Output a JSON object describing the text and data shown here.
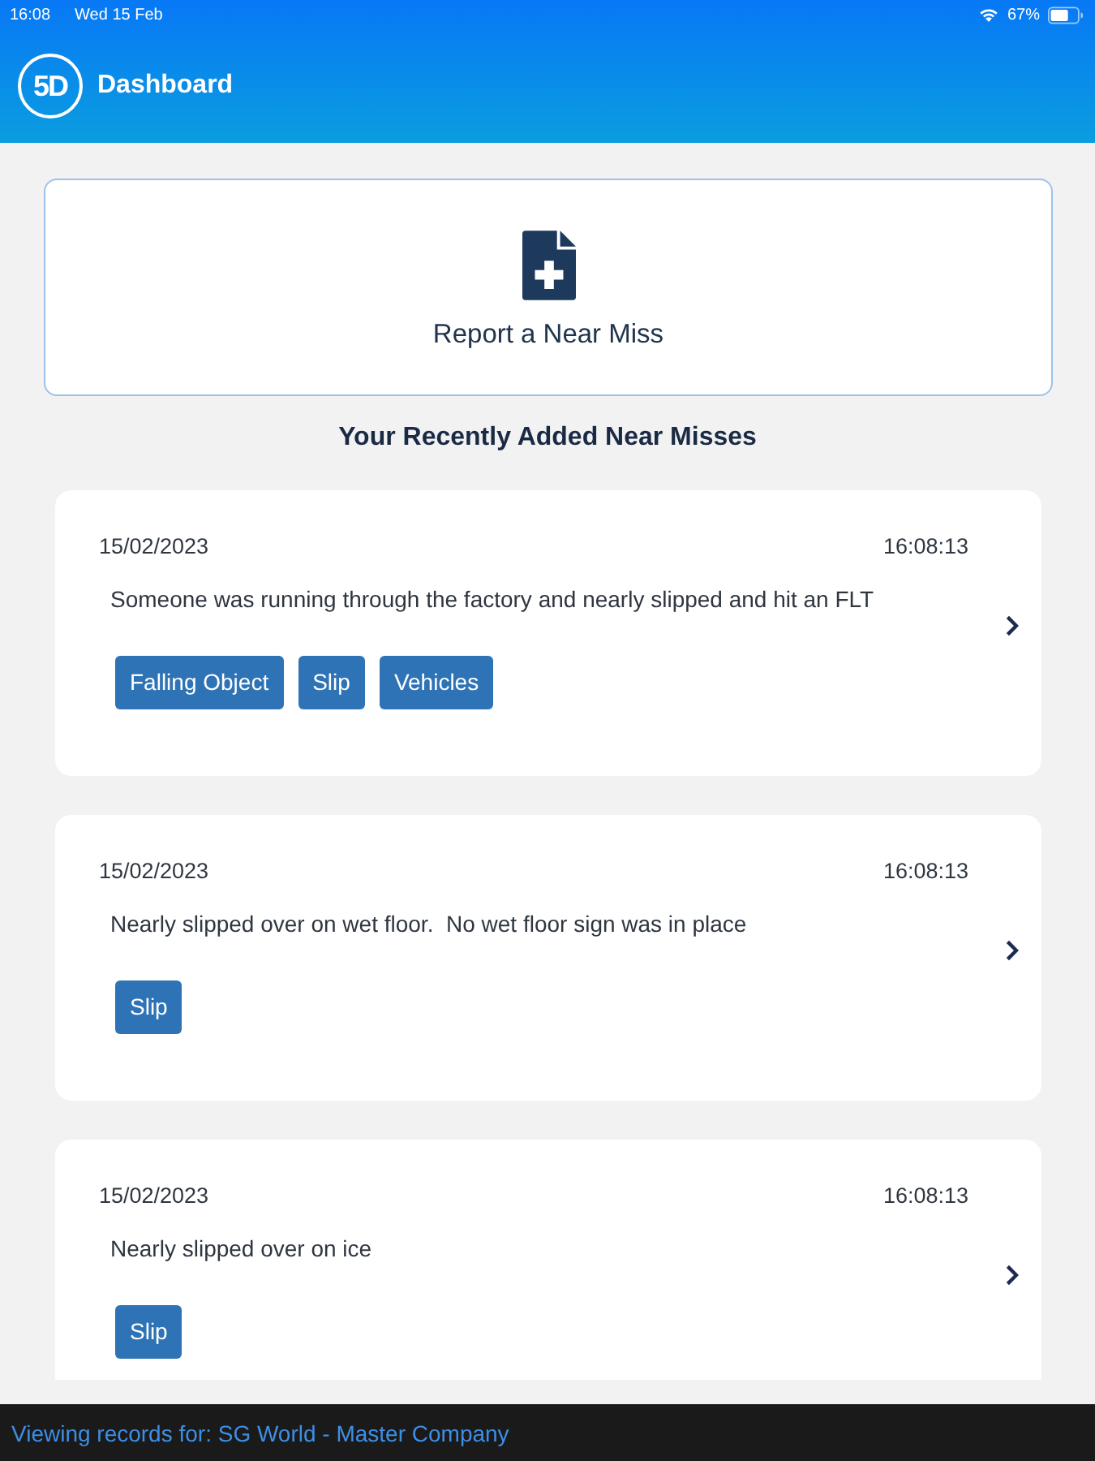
{
  "status_bar": {
    "time": "16:08",
    "date": "Wed 15 Feb",
    "battery": "67%"
  },
  "header": {
    "logo": "5D",
    "title": "Dashboard"
  },
  "report_button": {
    "label": "Report a Near Miss"
  },
  "section_title": "Your Recently Added Near Misses",
  "near_misses": [
    {
      "date": "15/02/2023",
      "time": "16:08:13",
      "description": "Someone was running through the factory and nearly slipped and hit an FLT",
      "tags": [
        "Falling Object",
        "Slip",
        "Vehicles"
      ]
    },
    {
      "date": "15/02/2023",
      "time": "16:08:13",
      "description": "Nearly slipped over on wet floor.  No wet floor sign was in place",
      "tags": [
        "Slip"
      ]
    },
    {
      "date": "15/02/2023",
      "time": "16:08:13",
      "description": "Nearly slipped over on ice",
      "tags": [
        "Slip"
      ]
    }
  ],
  "footer": {
    "text": "Viewing records for: SG World - Master Company"
  }
}
